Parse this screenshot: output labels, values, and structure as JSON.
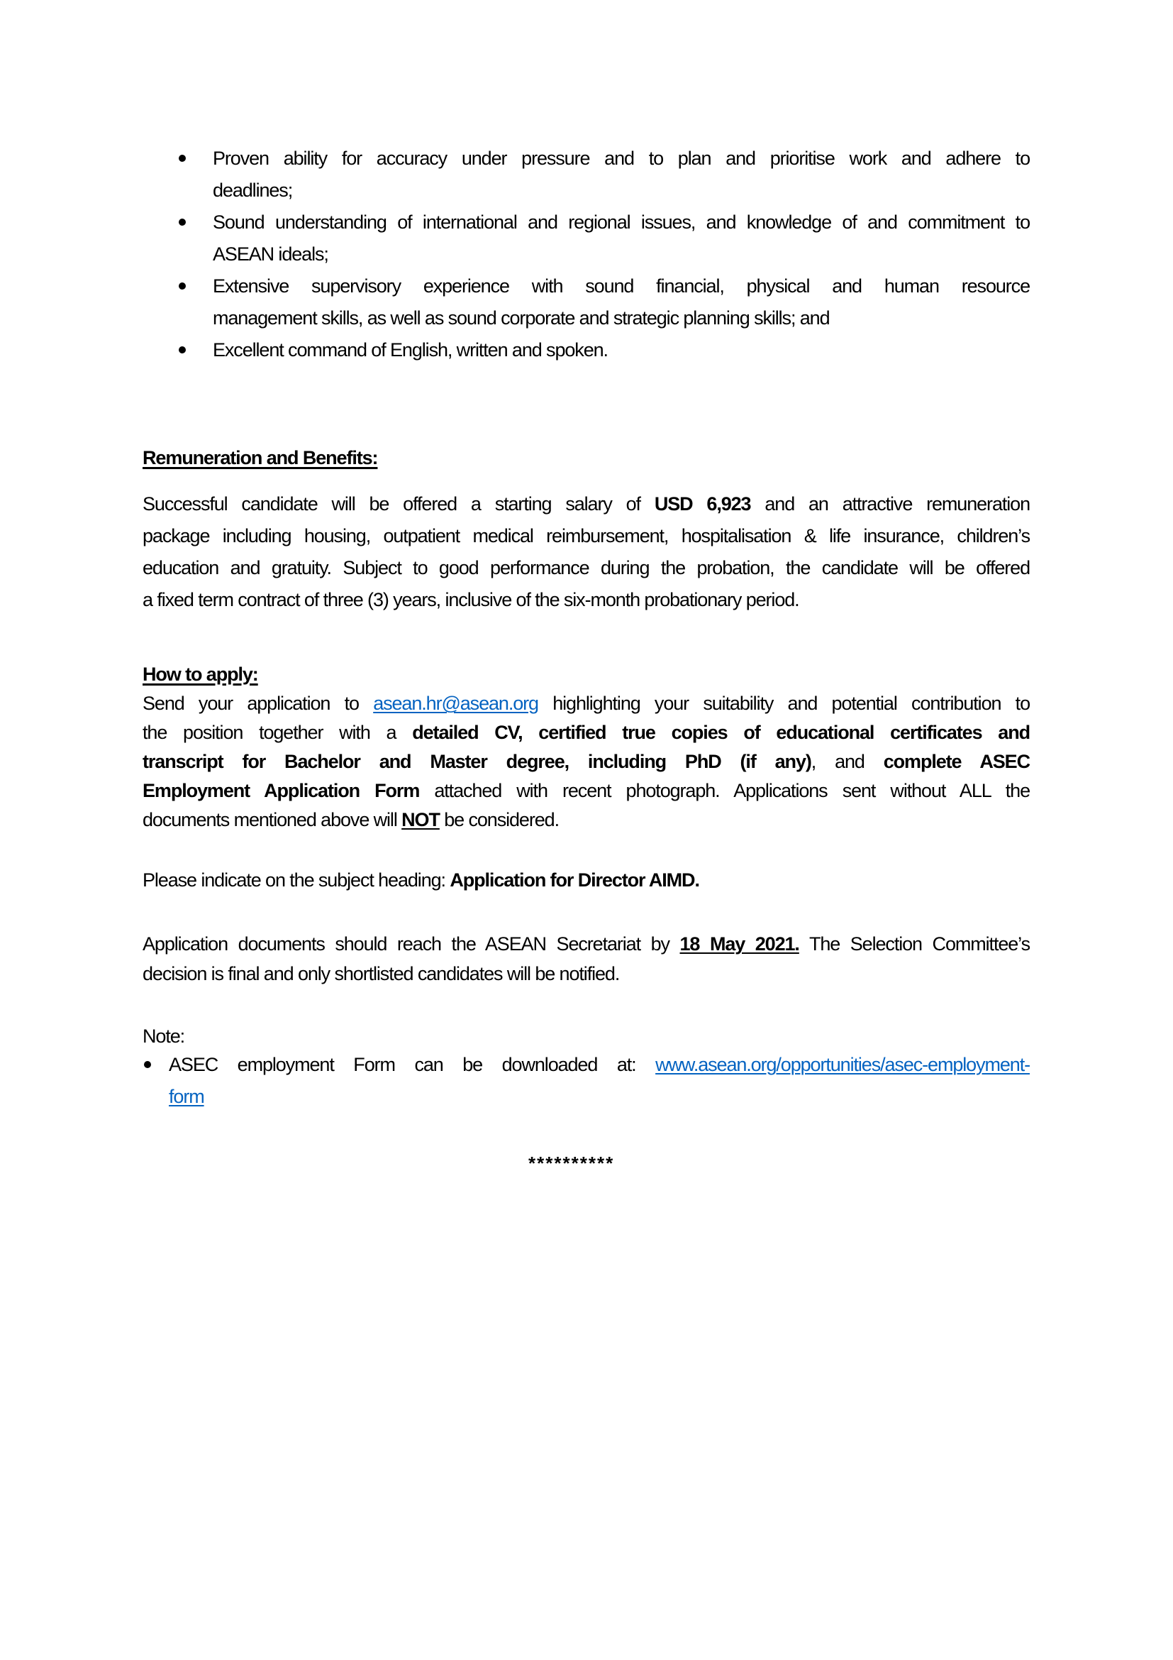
{
  "requirements": {
    "items": [
      {
        "lines": [
          [
            {
              "t": "Proven ability for accuracy under pressure and to plan and prioritise work and adhere to"
            }
          ],
          [
            {
              "t": "deadlines;"
            }
          ]
        ]
      },
      {
        "lines": [
          [
            {
              "t": "Sound understanding of international and regional issues, and knowledge of and commitment to"
            }
          ],
          [
            {
              "t": "ASEAN ideals;"
            }
          ]
        ]
      },
      {
        "lines": [
          [
            {
              "t": "Extensive supervisory experience with sound financial, physical and human resource"
            }
          ],
          [
            {
              "t": "management skills, as well as sound corporate and strategic planning skills; and"
            }
          ]
        ]
      },
      {
        "lines": [
          [
            {
              "t": "Excellent command of English, written and spoken."
            }
          ]
        ]
      }
    ]
  },
  "remuneration": {
    "heading": "Remuneration and Benefits:",
    "lines": [
      [
        {
          "t": "Successful candidate will be offered a starting salary of "
        },
        {
          "t": "USD 6,923",
          "s": "b"
        },
        {
          "t": " and an attractive remuneration"
        }
      ],
      [
        {
          "t": "package including housing, outpatient medical reimbursement, hospitalisation & life insurance, children’s"
        }
      ],
      [
        {
          "t": "education and gratuity. Subject to good performance during the probation, the candidate will be offered"
        }
      ],
      [
        {
          "t": "a fixed term contract of three (3) years, inclusive of the six-month probationary period."
        }
      ]
    ],
    "salary": "USD 6,923"
  },
  "how_to_apply": {
    "heading": "How to apply:",
    "email": "asean.hr@asean.org",
    "lines": [
      [
        {
          "t": "Send your application to "
        },
        {
          "t": "asean.hr@asean.org",
          "s": "lnk"
        },
        {
          "t": " highlighting your suitability and potential contribution to"
        }
      ],
      [
        {
          "t": "the position together with a "
        },
        {
          "t": "detailed CV, certified true copies of educational certificates and",
          "s": "b"
        }
      ],
      [
        {
          "t": "transcript for Bachelor and Master degree, including PhD (if any)",
          "s": "b"
        },
        {
          "t": ", and "
        },
        {
          "t": "complete ASEC",
          "s": "b"
        }
      ],
      [
        {
          "t": "Employment Application Form",
          "s": "b"
        },
        {
          "t": " attached with recent photograph. Applications sent without ALL the"
        }
      ],
      [
        {
          "t": "documents mentioned above will "
        },
        {
          "t": "NOT",
          "s": "b u"
        },
        {
          "t": " be considered."
        }
      ]
    ]
  },
  "subject": {
    "lines": [
      [
        {
          "t": "Please indicate on the subject heading: "
        },
        {
          "t": "Application for Director AIMD.",
          "s": "b"
        }
      ]
    ]
  },
  "deadline": {
    "date": "18 May 2021.",
    "lines": [
      [
        {
          "t": "Application documents should reach the ASEAN Secretariat by "
        },
        {
          "t": "18 May 2021.",
          "s": "b u"
        },
        {
          "t": " The Selection Committee’s"
        }
      ],
      [
        {
          "t": "decision is final and only shortlisted candidates will be notified."
        }
      ]
    ]
  },
  "note": {
    "label": "Note:",
    "lines": [
      [
        {
          "t": "ASEC employment Form can be downloaded at: "
        },
        {
          "t": "www.asean.org/opportunities/asec-employment-",
          "s": "lnk"
        }
      ],
      [
        {
          "t": "form",
          "s": "lnk"
        }
      ]
    ],
    "link": "www.asean.org/opportunities/asec-employment-form"
  },
  "end_marker": "**********",
  "colors": {
    "text": "#000000",
    "link": "#0563C1"
  }
}
